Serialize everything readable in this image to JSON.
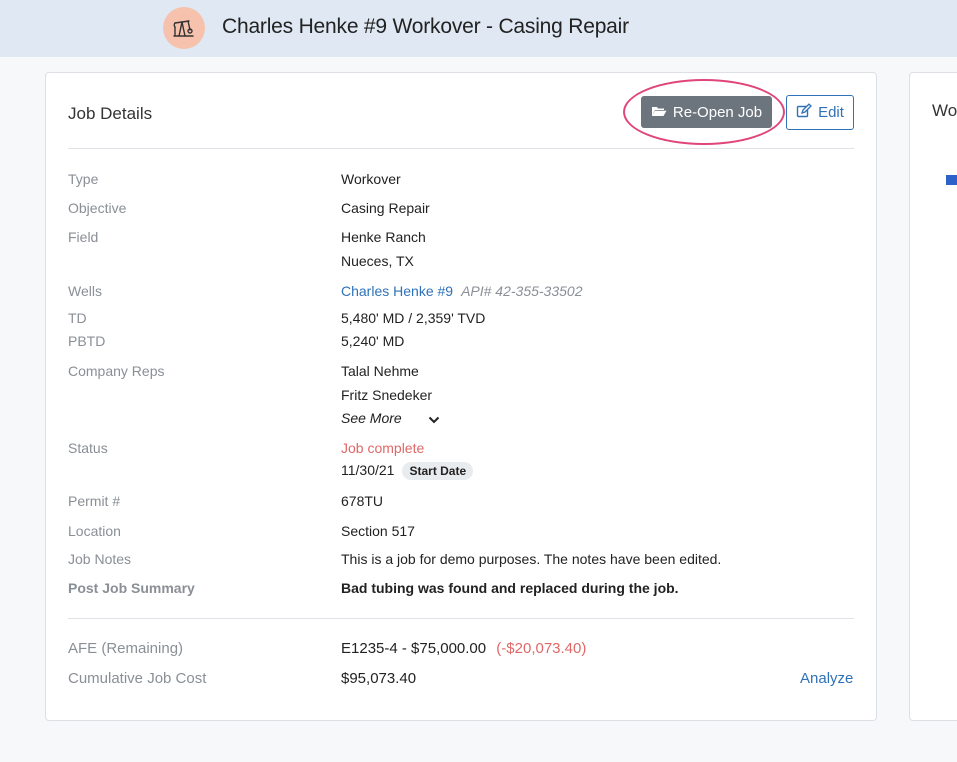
{
  "header": {
    "title": "Charles Henke #9 Workover - Casing Repair",
    "icon": "pumpjack-icon"
  },
  "job_details": {
    "title": "Job Details",
    "reopen_label": "Re-Open Job",
    "edit_label": "Edit",
    "rows": {
      "type": {
        "label": "Type",
        "value": "Workover"
      },
      "objective": {
        "label": "Objective",
        "value": "Casing Repair"
      },
      "field": {
        "label": "Field",
        "value": "Henke Ranch",
        "value2": "Nueces, TX"
      },
      "wells": {
        "label": "Wells",
        "value": "Charles Henke #9",
        "api": "API# 42-355-33502"
      },
      "td": {
        "label": "TD",
        "value": "5,480' MD / 2,359' TVD"
      },
      "pbtd": {
        "label": "PBTD",
        "value": "5,240' MD"
      },
      "company_reps": {
        "label": "Company Reps",
        "values": [
          "Talal Nehme",
          "Fritz Snedeker"
        ],
        "see_more": "See More"
      },
      "status": {
        "label": "Status",
        "value": "Job complete",
        "date": "11/30/21",
        "badge": "Start Date"
      },
      "permit": {
        "label": "Permit #",
        "value": "678TU"
      },
      "location": {
        "label": "Location",
        "value": "Section 517"
      },
      "job_notes": {
        "label": "Job Notes",
        "value": "This is a job for demo purposes. The notes have been edited."
      },
      "post_job_summary": {
        "label": "Post Job Summary",
        "value": "Bad tubing was found and replaced during the job."
      }
    },
    "afe": {
      "label": "AFE (Remaining)",
      "value": "E1235-4 - $75,000.00",
      "remaining": "(-$20,073.40)"
    },
    "cost": {
      "label": "Cumulative Job Cost",
      "value": "$95,073.40",
      "analyze": "Analyze"
    }
  },
  "right_panel": {
    "title": "Wo"
  },
  "colors": {
    "accent": "#2f72b8",
    "header_bg": "#dfe8f3",
    "status_red": "#e06868",
    "highlight": "#e0457b"
  }
}
